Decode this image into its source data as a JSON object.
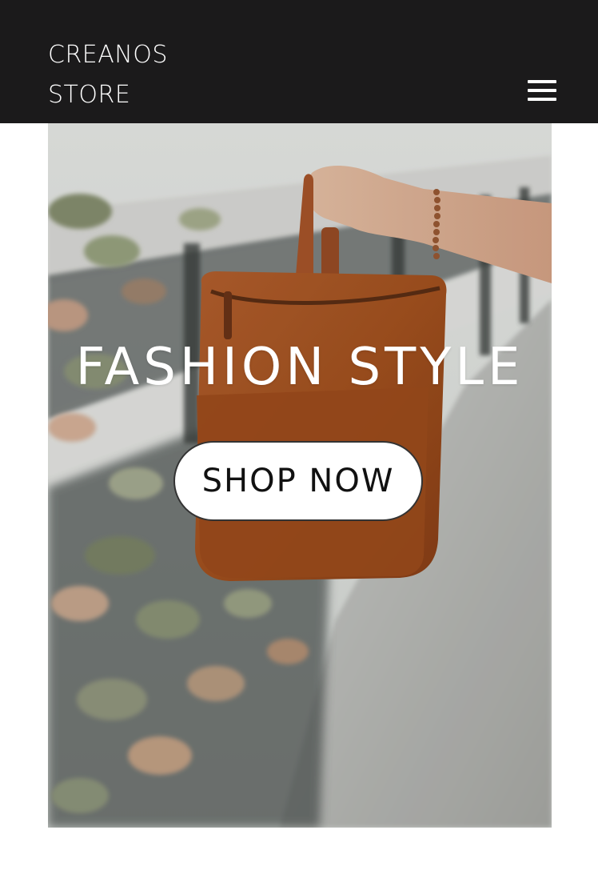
{
  "header": {
    "brand_line1": "CREANOS",
    "brand_line2": "STORE",
    "background_color": "#1b1a1b",
    "menu_icon": "hamburger-menu-icon"
  },
  "hero": {
    "title": "FASHION STYLE",
    "cta_label": "SHOP NOW",
    "image_subject": "hand holding brown leather backpack on bridge"
  }
}
